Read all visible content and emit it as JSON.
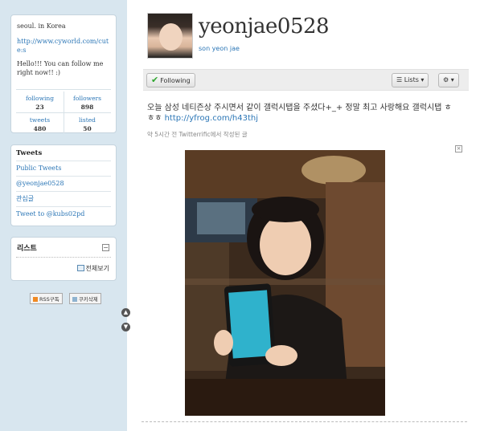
{
  "profile": {
    "location": "seoul. in Korea",
    "url": "http://www.cyworld.com/cute:s",
    "bio": "Hello!!! You can follow me right now!! :)",
    "username": "yeonjae0528",
    "real_name": "son yeon jae"
  },
  "stats": {
    "following_label": "following",
    "following_value": "23",
    "followers_label": "followers",
    "followers_value": "898",
    "tweets_label": "tweets",
    "tweets_value": "480",
    "listed_label": "listed",
    "listed_value": "50"
  },
  "tweets_menu": {
    "title": "Tweets",
    "items": [
      "Public Tweets",
      "@yeonjae0528",
      "관심글",
      "Tweet to @kubs02pd"
    ]
  },
  "list_box": {
    "title": "리스트",
    "collapse_glyph": "−",
    "view_all": "전체보기"
  },
  "mini_buttons": {
    "rss": "RSS구독",
    "cookie": "쿠키삭제"
  },
  "actions": {
    "following": "Following",
    "lists": "Lists",
    "dropdown_glyph": "▾",
    "gear_glyph": "⚙"
  },
  "tweet": {
    "text": "오늘 삼성 네티즌상 주시면서 같이 갤럭시탭을 주셨다+_+ 정말 최고 사랑해요 갤럭시탭 ㅎㅎㅎ",
    "link": "http://yfrog.com/h43thj",
    "meta": "약 5시간 전 Twitterrific에서 작성된 글",
    "close_glyph": "×"
  },
  "colors": {
    "sidebar_bg": "#d8e6ef",
    "link": "#2b76b6"
  }
}
